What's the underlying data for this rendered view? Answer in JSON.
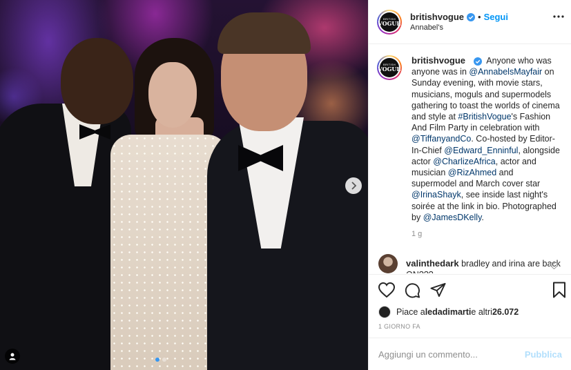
{
  "post": {
    "account": {
      "username": "britishvogue",
      "verified": true,
      "logo_line1": "BRITISH",
      "logo_line2": "VOGUE",
      "follow_label": "Segui",
      "location": "Annabel's"
    },
    "caption": {
      "username": "britishvogue",
      "parts": [
        {
          "text": "Anyone who was anyone was in "
        },
        {
          "text": "@AnnabelsMayfair",
          "link": true
        },
        {
          "text": " on Sunday evening, with movie stars, musicians, moguls and supermodels gathering to toast the worlds of cinema and style at "
        },
        {
          "text": "#BritishVogue",
          "link": true
        },
        {
          "text": "'s Fashion And Film Party in celebration with "
        },
        {
          "text": "@TiffanyandCo",
          "link": true
        },
        {
          "text": ". Co-hosted by Editor-In-Chief "
        },
        {
          "text": "@Edward_Enninful",
          "link": true
        },
        {
          "text": ", alongside actor "
        },
        {
          "text": "@CharlizeAfrica",
          "link": true
        },
        {
          "text": ", actor and musician "
        },
        {
          "text": "@RizAhmed",
          "link": true
        },
        {
          "text": " and supermodel and March cover star "
        },
        {
          "text": "@IrinaShayk",
          "link": true
        },
        {
          "text": ", see inside last night's soirée at the link in bio. Photographed by "
        },
        {
          "text": "@JamesDKelly",
          "link": true
        },
        {
          "text": "."
        }
      ],
      "age": "1 g"
    },
    "comment": {
      "username": "valinthedark",
      "text": "bradley and irina are back ON???"
    },
    "likes": {
      "prefix": "Piace a ",
      "user": "ledadimarti",
      "middle": " e altri ",
      "count": "26.072"
    },
    "date": "1 GIORNO FA",
    "add_comment": {
      "placeholder": "Aggiungi un commento...",
      "publish_label": "Pubblica"
    },
    "carousel": {
      "slide_count": 2,
      "active_index": 0
    }
  },
  "icons": {
    "verified": "verified-badge-icon",
    "more": "more-options-icon",
    "next": "chevron-right-icon",
    "tag": "user-tag-icon",
    "like": "heart-icon",
    "comment": "comment-icon",
    "share": "share-icon",
    "save": "bookmark-icon"
  },
  "colors": {
    "link": "#00376b",
    "follow": "#0095f6",
    "publish_disabled": "#b2dffc",
    "muted": "#8e8e8e"
  }
}
